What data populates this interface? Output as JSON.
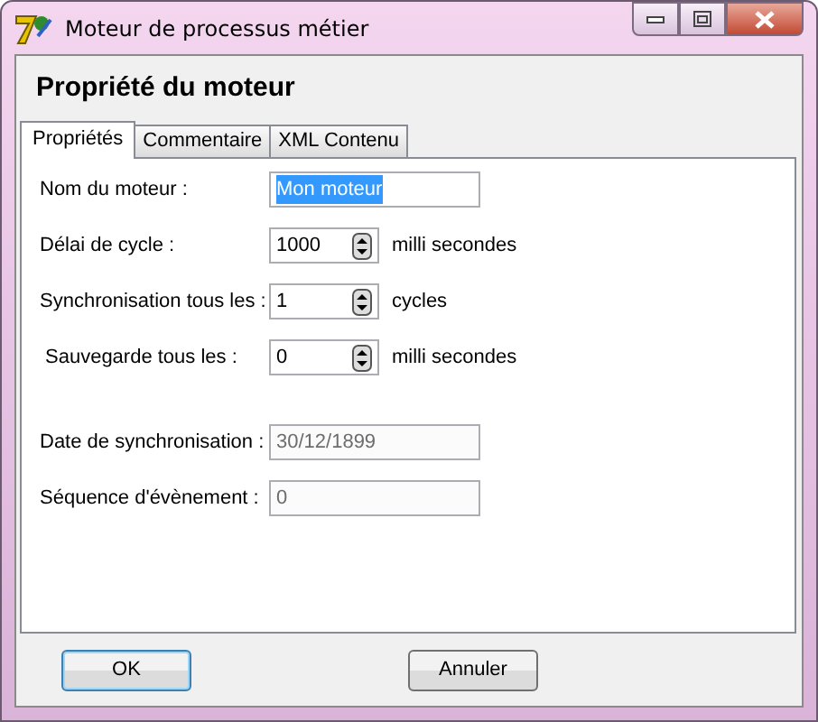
{
  "window": {
    "title": "Moteur de processus métier"
  },
  "header": "Propriété du moteur",
  "tabs": [
    {
      "label": "Propriétés",
      "selected": true
    },
    {
      "label": "Commentaire",
      "selected": false
    },
    {
      "label": "XML Contenu",
      "selected": false
    }
  ],
  "fields": [
    {
      "kind": "text",
      "label": "Nom du moteur :",
      "value": "Mon moteur",
      "text_selected": true,
      "disabled": false
    },
    {
      "kind": "spin",
      "label": "Délai de cycle :",
      "value": "1000",
      "unit": "milli secondes"
    },
    {
      "kind": "spin",
      "label": "Synchronisation tous les :",
      "value": "1",
      "unit": "cycles"
    },
    {
      "kind": "spin",
      "label": "Sauvegarde tous les :",
      "value": "0",
      "unit": "milli secondes"
    },
    {
      "kind": "gap"
    },
    {
      "kind": "text",
      "label": "Date de synchronisation :",
      "value": "30/12/1899",
      "text_selected": false,
      "disabled": true
    },
    {
      "kind": "text",
      "label": "Séquence d'évènement :",
      "value": "0",
      "text_selected": false,
      "disabled": true
    }
  ],
  "buttons": [
    {
      "label": "OK",
      "default": true
    },
    {
      "label": "Annuler",
      "default": false
    }
  ]
}
